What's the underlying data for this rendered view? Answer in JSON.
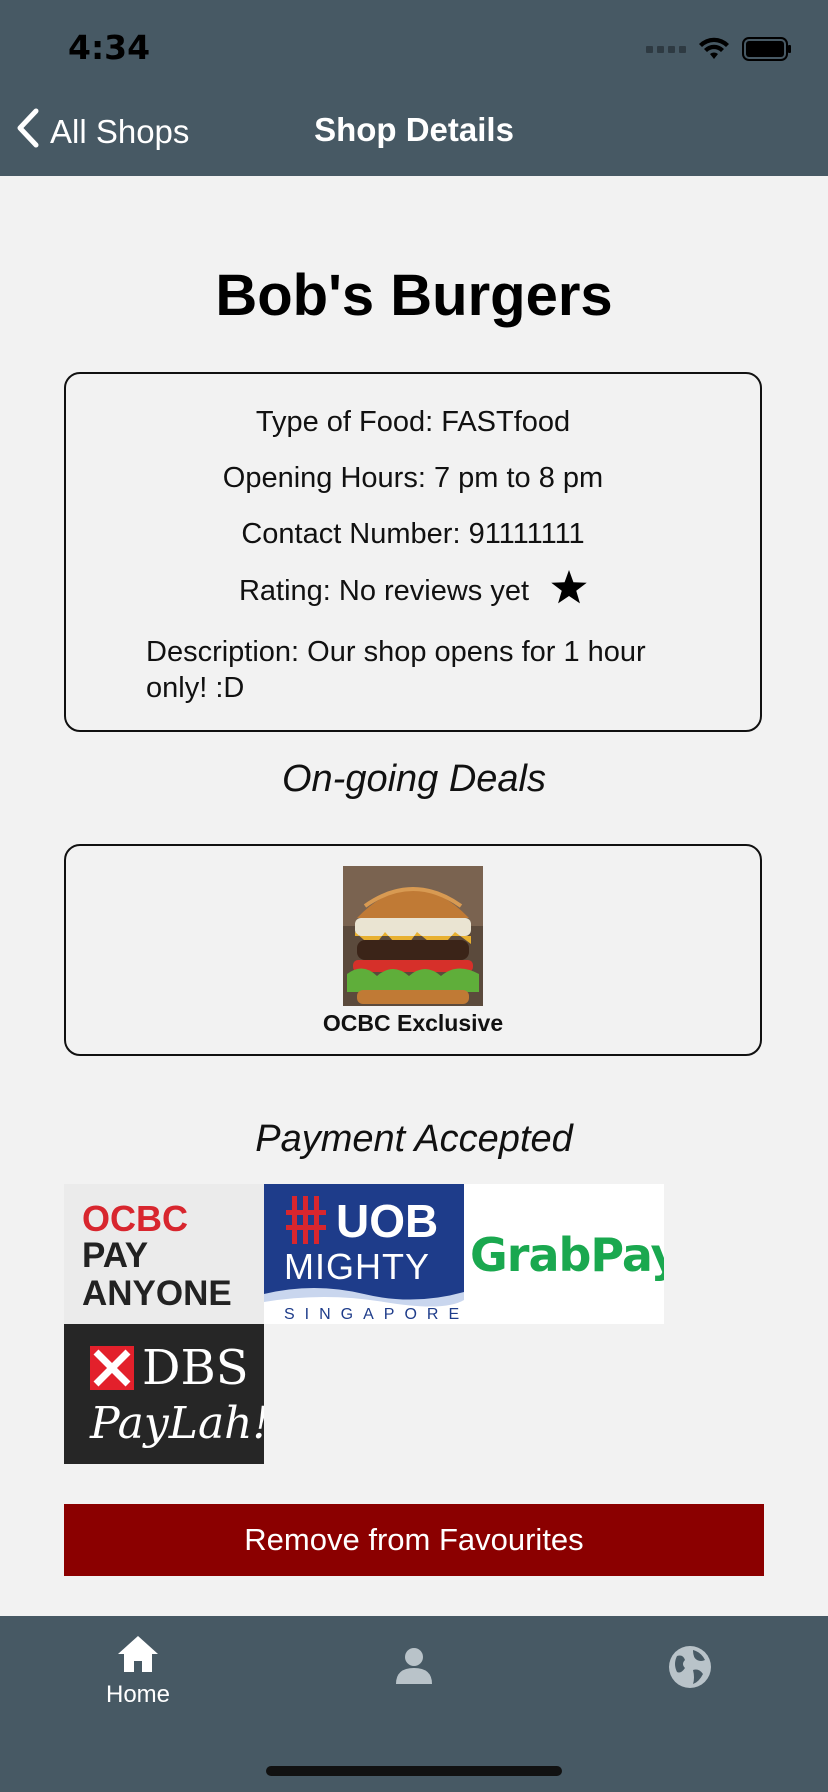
{
  "status": {
    "time": "4:34"
  },
  "nav": {
    "back_label": "All Shops",
    "title": "Shop Details"
  },
  "shop": {
    "name": "Bob's Burgers",
    "type_of_food": "Type of Food: FASTfood",
    "opening_hours": "Opening Hours: 7 pm to 8 pm",
    "contact": "Contact Number: 91111111",
    "rating": "Rating: No reviews yet",
    "description": "Description: Our shop opens for 1 hour only! :D"
  },
  "deals": {
    "title": "On-going Deals",
    "items": [
      {
        "label": "OCBC Exclusive"
      }
    ]
  },
  "payments": {
    "title": "Payment Accepted",
    "logos": [
      {
        "name": "ocbc-pay-anyone",
        "lines": [
          "OCBC",
          "PAY",
          "ANYONE"
        ]
      },
      {
        "name": "uob-mighty",
        "lines": [
          "UOB",
          "MIGHTY",
          "SINGAPORE"
        ]
      },
      {
        "name": "grabpay",
        "lines": [
          "GrabPay"
        ]
      },
      {
        "name": "dbs-paylah",
        "lines": [
          "DBS",
          "PayLah!"
        ]
      }
    ]
  },
  "actions": {
    "remove_label": "Remove from Favourites"
  },
  "tabs": [
    {
      "label": "Home",
      "icon": "home-icon",
      "active": true
    },
    {
      "label": "",
      "icon": "person-icon",
      "active": false
    },
    {
      "label": "",
      "icon": "globe-icon",
      "active": false
    }
  ],
  "colors": {
    "bar": "#475964",
    "accent_button": "#8b0000",
    "background": "#f2f2f2"
  }
}
